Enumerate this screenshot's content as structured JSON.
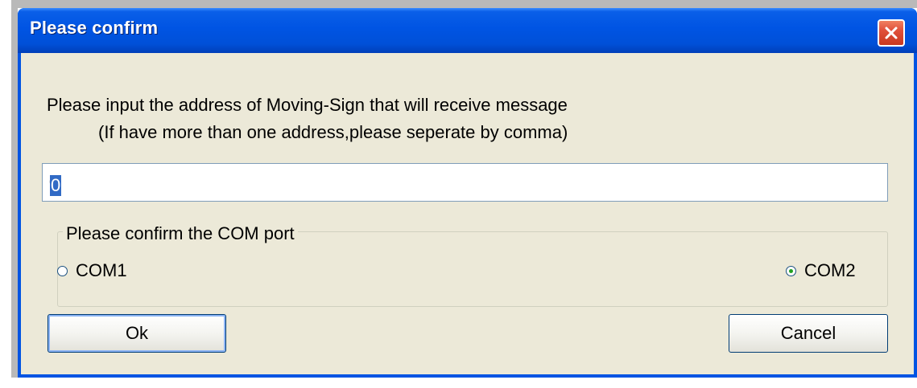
{
  "dialog": {
    "title": "Please confirm",
    "prompt_line1": "Please input the address of Moving-Sign that will receive message",
    "prompt_line2": "(If have more than one address,please seperate by comma)",
    "address_value": "0",
    "com_group": {
      "legend": "Please confirm the COM port",
      "options": [
        {
          "label": "COM1",
          "selected": false
        },
        {
          "label": "COM2",
          "selected": true
        }
      ]
    },
    "ok_label": "Ok",
    "cancel_label": "Cancel"
  },
  "colors": {
    "titlebar": "#0054e3",
    "client_bg": "#ece9d8",
    "close_button": "#e0503a",
    "selection": "#316ac5",
    "radio_dot": "#21a121"
  },
  "icons": {
    "close": "close-icon"
  }
}
